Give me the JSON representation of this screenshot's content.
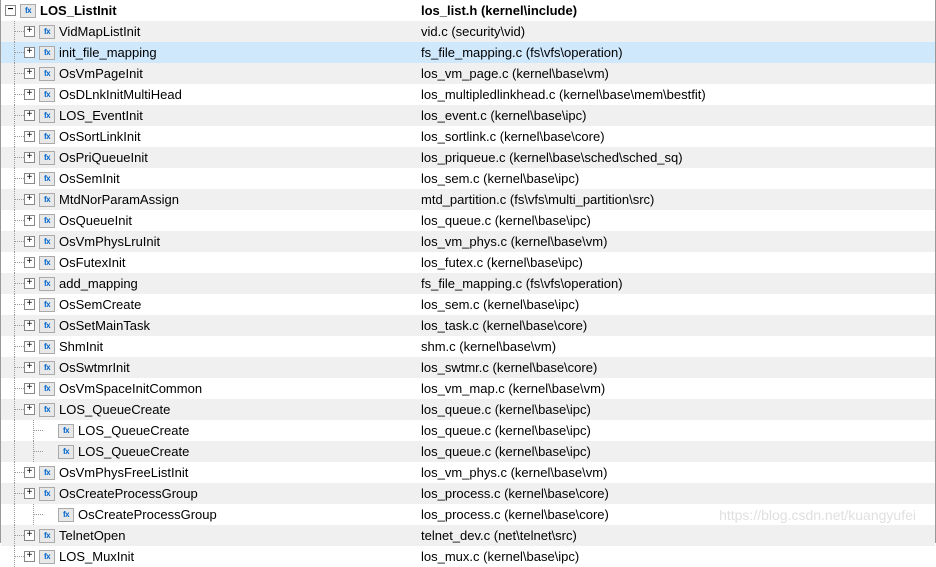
{
  "root": {
    "name": "LOS_ListInit",
    "path": "los_list.h (kernel\\include)"
  },
  "rows": [
    {
      "name": "VidMapListInit",
      "path": "vid.c (security\\vid)",
      "depth": 1,
      "has_children": true,
      "selected": false
    },
    {
      "name": "init_file_mapping",
      "path": "fs_file_mapping.c (fs\\vfs\\operation)",
      "depth": 1,
      "has_children": true,
      "selected": true
    },
    {
      "name": "OsVmPageInit",
      "path": "los_vm_page.c (kernel\\base\\vm)",
      "depth": 1,
      "has_children": true,
      "selected": false
    },
    {
      "name": "OsDLnkInitMultiHead",
      "path": "los_multipledlinkhead.c (kernel\\base\\mem\\bestfit)",
      "depth": 1,
      "has_children": true,
      "selected": false
    },
    {
      "name": "LOS_EventInit",
      "path": "los_event.c (kernel\\base\\ipc)",
      "depth": 1,
      "has_children": true,
      "selected": false
    },
    {
      "name": "OsSortLinkInit",
      "path": "los_sortlink.c (kernel\\base\\core)",
      "depth": 1,
      "has_children": true,
      "selected": false
    },
    {
      "name": "OsPriQueueInit",
      "path": "los_priqueue.c (kernel\\base\\sched\\sched_sq)",
      "depth": 1,
      "has_children": true,
      "selected": false
    },
    {
      "name": "OsSemInit",
      "path": "los_sem.c (kernel\\base\\ipc)",
      "depth": 1,
      "has_children": true,
      "selected": false
    },
    {
      "name": "MtdNorParamAssign",
      "path": "mtd_partition.c (fs\\vfs\\multi_partition\\src)",
      "depth": 1,
      "has_children": true,
      "selected": false
    },
    {
      "name": "OsQueueInit",
      "path": "los_queue.c (kernel\\base\\ipc)",
      "depth": 1,
      "has_children": true,
      "selected": false
    },
    {
      "name": "OsVmPhysLruInit",
      "path": "los_vm_phys.c (kernel\\base\\vm)",
      "depth": 1,
      "has_children": true,
      "selected": false
    },
    {
      "name": "OsFutexInit",
      "path": "los_futex.c (kernel\\base\\ipc)",
      "depth": 1,
      "has_children": true,
      "selected": false
    },
    {
      "name": "add_mapping",
      "path": "fs_file_mapping.c (fs\\vfs\\operation)",
      "depth": 1,
      "has_children": true,
      "selected": false
    },
    {
      "name": "OsSemCreate",
      "path": "los_sem.c (kernel\\base\\ipc)",
      "depth": 1,
      "has_children": true,
      "selected": false
    },
    {
      "name": "OsSetMainTask",
      "path": "los_task.c (kernel\\base\\core)",
      "depth": 1,
      "has_children": true,
      "selected": false
    },
    {
      "name": "ShmInit",
      "path": "shm.c (kernel\\base\\vm)",
      "depth": 1,
      "has_children": true,
      "selected": false
    },
    {
      "name": "OsSwtmrInit",
      "path": "los_swtmr.c (kernel\\base\\core)",
      "depth": 1,
      "has_children": true,
      "selected": false
    },
    {
      "name": "OsVmSpaceInitCommon",
      "path": "los_vm_map.c (kernel\\base\\vm)",
      "depth": 1,
      "has_children": true,
      "selected": false
    },
    {
      "name": "LOS_QueueCreate",
      "path": "los_queue.c (kernel\\base\\ipc)",
      "depth": 1,
      "has_children": true,
      "selected": false
    },
    {
      "name": "LOS_QueueCreate",
      "path": "los_queue.c (kernel\\base\\ipc)",
      "depth": 2,
      "has_children": false,
      "selected": false
    },
    {
      "name": "LOS_QueueCreate",
      "path": "los_queue.c (kernel\\base\\ipc)",
      "depth": 2,
      "has_children": false,
      "selected": false
    },
    {
      "name": "OsVmPhysFreeListInit",
      "path": "los_vm_phys.c (kernel\\base\\vm)",
      "depth": 1,
      "has_children": true,
      "selected": false
    },
    {
      "name": "OsCreateProcessGroup",
      "path": "los_process.c (kernel\\base\\core)",
      "depth": 1,
      "has_children": true,
      "selected": false
    },
    {
      "name": "OsCreateProcessGroup",
      "path": "los_process.c (kernel\\base\\core)",
      "depth": 2,
      "has_children": false,
      "selected": false
    },
    {
      "name": "TelnetOpen",
      "path": "telnet_dev.c (net\\telnet\\src)",
      "depth": 1,
      "has_children": true,
      "selected": false
    },
    {
      "name": "LOS_MuxInit",
      "path": "los_mux.c (kernel\\base\\ipc)",
      "depth": 1,
      "has_children": true,
      "selected": false
    }
  ],
  "icons": {
    "expander_collapsed": "+",
    "expander_expanded": "−",
    "function_marker": "fx"
  },
  "watermark": "https://blog.csdn.net/kuangyufei"
}
